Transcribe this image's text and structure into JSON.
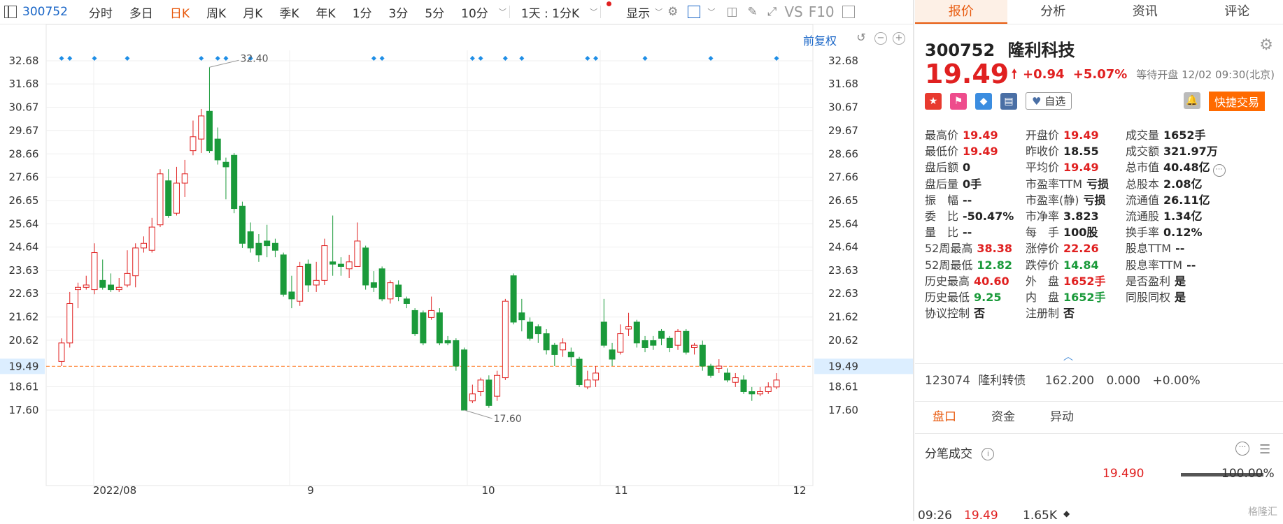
{
  "toolbar": {
    "code": "300752",
    "periods": [
      "分时",
      "多日",
      "日K",
      "周K",
      "月K",
      "季K",
      "年K",
      "1分",
      "3分",
      "5分",
      "10分"
    ],
    "active_period": "日K",
    "interval": "1天 : 1分K",
    "display": "显示",
    "vs": "VS",
    "f10": "F10",
    "fuquan": "前复权"
  },
  "chart": {
    "y_ticks": [
      "32.68",
      "31.68",
      "30.67",
      "29.67",
      "28.66",
      "27.66",
      "26.65",
      "25.64",
      "24.64",
      "23.63",
      "22.63",
      "21.62",
      "20.62",
      "19.49",
      "18.61",
      "17.60"
    ],
    "x_labels": [
      "2022/08",
      "9",
      "10",
      "11",
      "12"
    ],
    "current_price": "19.49",
    "high_label": "32.40",
    "low_label": "17.60"
  },
  "chart_data": {
    "type": "candlestick",
    "series": [
      {
        "o": 19.7,
        "c": 20.5,
        "h": 20.7,
        "l": 19.5
      },
      {
        "o": 20.5,
        "c": 22.2,
        "h": 22.7,
        "l": 20.3
      },
      {
        "o": 22.8,
        "c": 22.9,
        "h": 23.1,
        "l": 22.0
      },
      {
        "o": 22.9,
        "c": 23.0,
        "h": 23.4,
        "l": 22.8
      },
      {
        "o": 22.8,
        "c": 24.4,
        "h": 24.8,
        "l": 22.6
      },
      {
        "o": 23.2,
        "c": 22.9,
        "h": 24.1,
        "l": 22.8
      },
      {
        "o": 23.0,
        "c": 22.8,
        "h": 23.5,
        "l": 22.7
      },
      {
        "o": 22.8,
        "c": 22.9,
        "h": 23.3,
        "l": 22.7
      },
      {
        "o": 23.0,
        "c": 23.5,
        "h": 24.5,
        "l": 22.9
      },
      {
        "o": 23.4,
        "c": 24.6,
        "h": 24.8,
        "l": 22.9
      },
      {
        "o": 24.6,
        "c": 24.8,
        "h": 25.1,
        "l": 24.4
      },
      {
        "o": 24.5,
        "c": 25.5,
        "h": 25.9,
        "l": 24.4
      },
      {
        "o": 25.6,
        "c": 27.8,
        "h": 28.0,
        "l": 25.5
      },
      {
        "o": 27.5,
        "c": 26.0,
        "h": 28.0,
        "l": 25.9
      },
      {
        "o": 26.1,
        "c": 27.4,
        "h": 28.1,
        "l": 26.0
      },
      {
        "o": 27.4,
        "c": 27.8,
        "h": 28.4,
        "l": 26.8
      },
      {
        "o": 28.8,
        "c": 29.4,
        "h": 30.1,
        "l": 28.6
      },
      {
        "o": 29.3,
        "c": 30.3,
        "h": 30.6,
        "l": 28.7
      },
      {
        "o": 30.5,
        "c": 28.8,
        "h": 32.4,
        "l": 28.7
      },
      {
        "o": 29.3,
        "c": 28.4,
        "h": 29.8,
        "l": 28.2
      },
      {
        "o": 28.3,
        "c": 28.1,
        "h": 28.5,
        "l": 26.7
      },
      {
        "o": 28.6,
        "c": 26.3,
        "h": 28.7,
        "l": 26.1
      },
      {
        "o": 26.4,
        "c": 24.8,
        "h": 26.6,
        "l": 24.6
      },
      {
        "o": 25.3,
        "c": 24.6,
        "h": 25.7,
        "l": 24.4
      },
      {
        "o": 24.8,
        "c": 24.3,
        "h": 25.2,
        "l": 24.0
      },
      {
        "o": 24.9,
        "c": 24.7,
        "h": 25.6,
        "l": 24.2
      },
      {
        "o": 24.8,
        "c": 24.5,
        "h": 25.0,
        "l": 24.2
      },
      {
        "o": 24.3,
        "c": 22.6,
        "h": 24.4,
        "l": 22.5
      },
      {
        "o": 22.7,
        "c": 22.4,
        "h": 23.4,
        "l": 22.0
      },
      {
        "o": 22.3,
        "c": 23.8,
        "h": 24.0,
        "l": 22.1
      },
      {
        "o": 23.9,
        "c": 23.0,
        "h": 24.1,
        "l": 22.7
      },
      {
        "o": 23.0,
        "c": 23.2,
        "h": 24.0,
        "l": 22.7
      },
      {
        "o": 23.2,
        "c": 24.7,
        "h": 25.0,
        "l": 23.0
      },
      {
        "o": 24.0,
        "c": 23.9,
        "h": 26.0,
        "l": 23.4
      },
      {
        "o": 23.9,
        "c": 23.8,
        "h": 24.2,
        "l": 23.4
      },
      {
        "o": 23.7,
        "c": 24.0,
        "h": 24.3,
        "l": 23.3
      },
      {
        "o": 23.8,
        "c": 24.9,
        "h": 25.7,
        "l": 23.8
      },
      {
        "o": 24.6,
        "c": 23.0,
        "h": 24.7,
        "l": 22.8
      },
      {
        "o": 23.1,
        "c": 22.9,
        "h": 23.6,
        "l": 22.7
      },
      {
        "o": 23.7,
        "c": 22.4,
        "h": 23.8,
        "l": 22.3
      },
      {
        "o": 22.4,
        "c": 23.1,
        "h": 23.2,
        "l": 22.2
      },
      {
        "o": 23.0,
        "c": 22.5,
        "h": 23.2,
        "l": 22.3
      },
      {
        "o": 22.4,
        "c": 22.2,
        "h": 22.5,
        "l": 22.0
      },
      {
        "o": 21.9,
        "c": 20.9,
        "h": 22.0,
        "l": 20.8
      },
      {
        "o": 21.8,
        "c": 20.5,
        "h": 21.9,
        "l": 20.4
      },
      {
        "o": 21.6,
        "c": 21.9,
        "h": 22.5,
        "l": 21.5
      },
      {
        "o": 21.8,
        "c": 20.5,
        "h": 22.0,
        "l": 20.4
      },
      {
        "o": 20.6,
        "c": 20.5,
        "h": 20.8,
        "l": 20.4
      },
      {
        "o": 20.6,
        "c": 19.5,
        "h": 20.7,
        "l": 19.3
      },
      {
        "o": 20.2,
        "c": 17.6,
        "h": 20.3,
        "l": 17.6
      },
      {
        "o": 18.0,
        "c": 18.3,
        "h": 18.7,
        "l": 17.9
      },
      {
        "o": 18.4,
        "c": 18.9,
        "h": 19.0,
        "l": 18.2
      },
      {
        "o": 18.9,
        "c": 17.8,
        "h": 19.1,
        "l": 17.7
      },
      {
        "o": 18.2,
        "c": 19.1,
        "h": 19.3,
        "l": 18.0
      },
      {
        "o": 19.0,
        "c": 22.3,
        "h": 22.4,
        "l": 18.9
      },
      {
        "o": 23.4,
        "c": 21.4,
        "h": 23.5,
        "l": 21.3
      },
      {
        "o": 21.8,
        "c": 21.5,
        "h": 22.4,
        "l": 21.0
      },
      {
        "o": 21.4,
        "c": 20.7,
        "h": 21.6,
        "l": 20.6
      },
      {
        "o": 21.2,
        "c": 20.9,
        "h": 21.3,
        "l": 20.5
      },
      {
        "o": 20.9,
        "c": 20.2,
        "h": 21.1,
        "l": 20.0
      },
      {
        "o": 20.4,
        "c": 20.0,
        "h": 20.5,
        "l": 19.5
      },
      {
        "o": 20.2,
        "c": 20.5,
        "h": 20.7,
        "l": 19.9
      },
      {
        "o": 20.1,
        "c": 19.9,
        "h": 20.3,
        "l": 19.5
      },
      {
        "o": 19.8,
        "c": 18.7,
        "h": 19.9,
        "l": 18.6
      },
      {
        "o": 18.6,
        "c": 18.9,
        "h": 19.3,
        "l": 18.5
      },
      {
        "o": 18.9,
        "c": 19.2,
        "h": 19.5,
        "l": 18.6
      },
      {
        "o": 21.4,
        "c": 20.4,
        "h": 22.4,
        "l": 20.3
      },
      {
        "o": 20.2,
        "c": 19.8,
        "h": 20.5,
        "l": 19.5
      },
      {
        "o": 20.1,
        "c": 20.9,
        "h": 21.3,
        "l": 20.0
      },
      {
        "o": 21.1,
        "c": 21.2,
        "h": 21.8,
        "l": 20.8
      },
      {
        "o": 21.4,
        "c": 20.5,
        "h": 21.5,
        "l": 20.3
      },
      {
        "o": 20.6,
        "c": 20.3,
        "h": 20.8,
        "l": 20.1
      },
      {
        "o": 20.6,
        "c": 20.4,
        "h": 20.8,
        "l": 20.2
      },
      {
        "o": 21.0,
        "c": 20.7,
        "h": 21.1,
        "l": 20.4
      },
      {
        "o": 20.7,
        "c": 20.3,
        "h": 20.8,
        "l": 20.1
      },
      {
        "o": 20.4,
        "c": 21.0,
        "h": 21.1,
        "l": 20.2
      },
      {
        "o": 21.0,
        "c": 20.1,
        "h": 21.1,
        "l": 20.0
      },
      {
        "o": 20.3,
        "c": 20.4,
        "h": 20.5,
        "l": 20.0
      },
      {
        "o": 20.4,
        "c": 19.5,
        "h": 20.6,
        "l": 19.3
      },
      {
        "o": 19.5,
        "c": 19.1,
        "h": 19.6,
        "l": 19.0
      },
      {
        "o": 19.4,
        "c": 19.5,
        "h": 19.8,
        "l": 19.2
      },
      {
        "o": 19.2,
        "c": 18.9,
        "h": 19.4,
        "l": 18.8
      },
      {
        "o": 18.8,
        "c": 19.0,
        "h": 19.2,
        "l": 18.6
      },
      {
        "o": 18.9,
        "c": 18.4,
        "h": 19.1,
        "l": 18.3
      },
      {
        "o": 18.4,
        "c": 18.3,
        "h": 18.6,
        "l": 18.0
      },
      {
        "o": 18.3,
        "c": 18.4,
        "h": 18.6,
        "l": 18.2
      },
      {
        "o": 18.4,
        "c": 18.6,
        "h": 18.8,
        "l": 18.3
      },
      {
        "o": 18.6,
        "c": 18.9,
        "h": 19.2,
        "l": 18.5
      }
    ],
    "marker_indices": [
      0,
      1,
      4,
      8,
      17,
      19,
      20,
      23,
      38,
      39,
      50,
      51,
      54,
      56,
      64,
      65,
      71,
      79,
      87
    ],
    "ylim": [
      17.6,
      32.68
    ]
  },
  "quote": {
    "code": "300752",
    "name": "隆利科技",
    "price": "19.49",
    "change": "+0.94",
    "change_pct": "+5.07%",
    "status": "等待开盘 12/02 09:30(北京)",
    "watch_label": "自选",
    "quick_trade": "快捷交易"
  },
  "tabs": [
    "报价",
    "分析",
    "资讯",
    "评论"
  ],
  "stats": [
    [
      {
        "label": "最高价",
        "value": "19.49",
        "color": "red"
      },
      {
        "label": "开盘价",
        "value": "19.49",
        "color": "red"
      },
      {
        "label": "成交量",
        "value": "1652手",
        "color": ""
      }
    ],
    [
      {
        "label": "最低价",
        "value": "19.49",
        "color": "red"
      },
      {
        "label": "昨收价",
        "value": "18.55",
        "color": ""
      },
      {
        "label": "成交额",
        "value": "321.97万",
        "color": ""
      }
    ],
    [
      {
        "label": "盘后额",
        "value": "0",
        "color": ""
      },
      {
        "label": "平均价",
        "value": "19.49",
        "color": "red"
      },
      {
        "label": "总市值",
        "value": "40.48亿",
        "color": ""
      }
    ],
    [
      {
        "label": "盘后量",
        "value": "0手",
        "color": ""
      },
      {
        "label": "市盈率TTM",
        "value": "亏损",
        "color": ""
      },
      {
        "label": "总股本",
        "value": "2.08亿",
        "color": ""
      }
    ],
    [
      {
        "label": "振　幅",
        "value": "--",
        "color": ""
      },
      {
        "label": "市盈率(静)",
        "value": "亏损",
        "color": ""
      },
      {
        "label": "流通值",
        "value": "26.11亿",
        "color": ""
      }
    ],
    [
      {
        "label": "委　比",
        "value": "-50.47%",
        "color": ""
      },
      {
        "label": "市净率",
        "value": "3.823",
        "color": ""
      },
      {
        "label": "流通股",
        "value": "1.34亿",
        "color": ""
      }
    ],
    [
      {
        "label": "量　比",
        "value": "--",
        "color": ""
      },
      {
        "label": "每　手",
        "value": "100股",
        "color": ""
      },
      {
        "label": "换手率",
        "value": "0.12%",
        "color": ""
      }
    ],
    [
      {
        "label": "52周最高",
        "value": "38.38",
        "color": "red"
      },
      {
        "label": "涨停价",
        "value": "22.26",
        "color": "red"
      },
      {
        "label": "股息TTM",
        "value": "--",
        "color": ""
      }
    ],
    [
      {
        "label": "52周最低",
        "value": "12.82",
        "color": "green"
      },
      {
        "label": "跌停价",
        "value": "14.84",
        "color": "green"
      },
      {
        "label": "股息率TTM",
        "value": "--",
        "color": ""
      }
    ],
    [
      {
        "label": "历史最高",
        "value": "40.60",
        "color": "red"
      },
      {
        "label": "外　盘",
        "value": "1652手",
        "color": "red"
      },
      {
        "label": "是否盈利",
        "value": "是",
        "color": ""
      }
    ],
    [
      {
        "label": "历史最低",
        "value": "9.25",
        "color": "green"
      },
      {
        "label": "内　盘",
        "value": "1652手",
        "color": "green"
      },
      {
        "label": "同股同权",
        "value": "是",
        "color": ""
      }
    ],
    [
      {
        "label": "协议控制",
        "value": "否",
        "color": ""
      },
      {
        "label": "注册制",
        "value": "否",
        "color": ""
      },
      {
        "label": "",
        "value": "",
        "color": ""
      }
    ]
  ],
  "bond": {
    "code": "123074",
    "name": "隆利转债",
    "price": "162.200",
    "change": "0.000",
    "change_pct": "+0.00%"
  },
  "subtabs": [
    "盘口",
    "资金",
    "异动"
  ],
  "ticks": {
    "title": "分笔成交",
    "price": "19.490",
    "pct": "100.00%",
    "row": {
      "time": "09:26",
      "price": "19.49",
      "vol": "1.65K"
    }
  },
  "watermark": "格隆汇",
  "colors": {
    "up": "#e02020",
    "down": "#1a9a3a",
    "accent": "#e8590c",
    "link": "#1a66c7"
  }
}
